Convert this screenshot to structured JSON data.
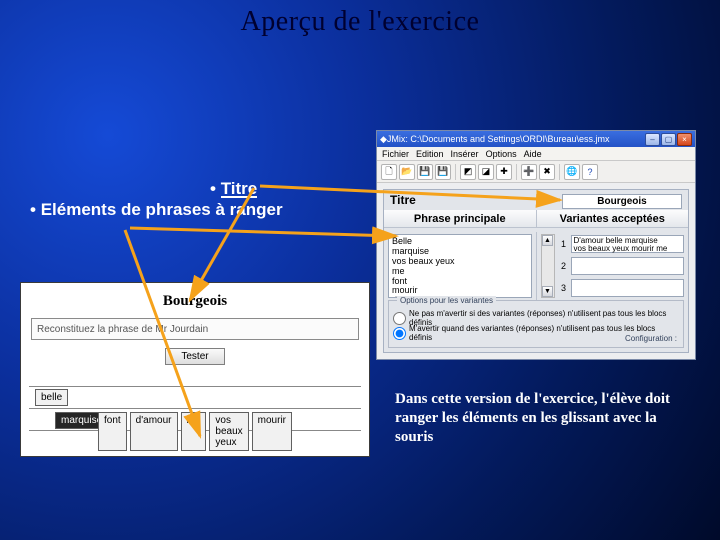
{
  "slide": {
    "title": "Aperçu de l'exercice",
    "bullets": {
      "titre": "Titre",
      "elements": "Eléments de phrases à ranger"
    },
    "description": "Dans cette version de l'exercice, l'élève doit ranger les éléments en les glissant avec la souris"
  },
  "window": {
    "title": "JMix: C:\\Documents and Settings\\ORDI\\Bureau\\ess.jmx",
    "menus": [
      "Fichier",
      "Edition",
      "Insérer",
      "Options",
      "Aide"
    ],
    "section_titre": "Titre",
    "titre_value": "Bourgeois",
    "headers": {
      "left": "Phrase principale",
      "right": "Variantes acceptées"
    },
    "words": "Belle\nmarquise\nvos beaux yeux\nme\nfont\nmourir\nd'amour",
    "variants": [
      {
        "n": "1",
        "text": "D'amour belle marquise\nvos beaux yeux  mourir me"
      },
      {
        "n": "2",
        "text": ""
      },
      {
        "n": "3",
        "text": ""
      }
    ],
    "options": {
      "group": "Options pour les variantes",
      "o1": "Ne pas m'avertir si des variantes (réponses) n'utilisent pas tous les blocs définis",
      "o2": "M'avertir quand des variantes (réponses) n'utilisent pas tous les blocs définis",
      "config": "Configuration :"
    }
  },
  "preview": {
    "title": "Bourgeois",
    "instruction": "Reconstituez la phrase de Mr Jourdain",
    "tester": "Tester",
    "placed": {
      "belle": "belle",
      "marquise": "marquise"
    },
    "tray": [
      "font",
      "d'amour",
      "me",
      "vos beaux yeux",
      "mourir"
    ]
  }
}
